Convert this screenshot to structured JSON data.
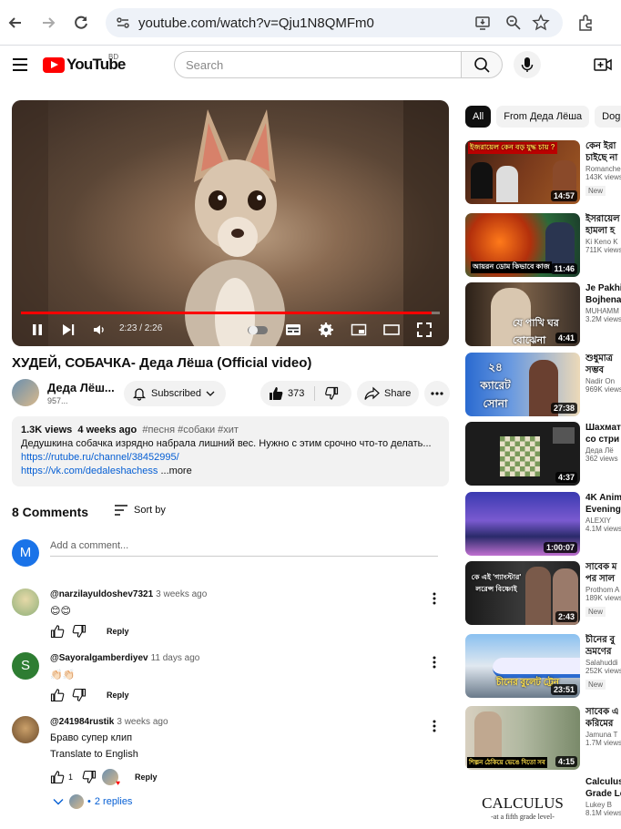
{
  "browser": {
    "url": "youtube.com/watch?v=Qju1N8QMFm0"
  },
  "header": {
    "logo_text": "YouTube",
    "country_code": "BD",
    "search_placeholder": "Search"
  },
  "player": {
    "time": "2:23 / 2:26",
    "progress_fraction": 0.98
  },
  "video": {
    "title": "ХУДЕЙ, СОБАЧКА- Деда Лёша (Official video)",
    "channel_name": "Деда Лёш...",
    "channel_subs": "957...",
    "subscribed_label": "Subscribed",
    "likes": "373",
    "share_label": "Share"
  },
  "description": {
    "views": "1.3K views",
    "age": "4 weeks ago",
    "tags": "#песня #собаки #хит",
    "text": "Дедушкина собачка изрядно набрала лишний вес. Нужно с этим срочно что-то делать...",
    "link1": "https://rutube.ru/channel/38452995/",
    "link2": "https://vk.com/dedaleshachess",
    "more": "...more"
  },
  "comments": {
    "count_label": "8 Comments",
    "sort_label": "Sort by",
    "my_avatar_letter": "M",
    "add_placeholder": "Add a comment...",
    "items": [
      {
        "author": "@narzilayuldoshev7321",
        "when": "3 weeks ago",
        "text": "😊😊",
        "reply": "Reply"
      },
      {
        "author": "@Sayoralgamberdiyev",
        "when": "11 days ago",
        "avatar_letter": "S",
        "text": "👏🏻👏🏻",
        "reply": "Reply"
      },
      {
        "author": "@241984rustik",
        "when": "3 weeks ago",
        "text": "Браво супер клип",
        "translate": "Translate to English",
        "likes": "1",
        "reply": "Reply",
        "replies": "2 replies"
      }
    ]
  },
  "sidebar": {
    "chips": [
      "All",
      "From Деда Лёша",
      "Dog"
    ],
    "recommendations": [
      {
        "title": "কেন ইরা",
        "title2": "চাইছে না",
        "channel": "Romanche",
        "views": "143K views",
        "badge": "New",
        "duration": "14:57",
        "thumb_text": "ইজরায়েল কেন বড় যুদ্ধ চায় ?"
      },
      {
        "title": "ইসরায়েল",
        "title2": "হামলা হ",
        "channel": "Ki Keno K",
        "views": "711K views",
        "badge": "",
        "duration": "11:46",
        "thumb_text": "আয়রন ডোম কিভাবে কাজ"
      },
      {
        "title": "Je Pakhi",
        "title2": "Bojhena",
        "channel": "MUHAMM",
        "views": "3.2M views",
        "badge": "",
        "duration": "4:41",
        "thumb_text": "যে পাখি ঘর বোঝেনা"
      },
      {
        "title": "শুধুমাত্র",
        "title2": "সম্ভব",
        "channel": "Nadir On",
        "views": "969K views",
        "badge": "",
        "duration": "27:38",
        "thumb_text": "২৪ ক্যারেট সোনা"
      },
      {
        "title": "Шахмат",
        "title2": "со стри",
        "channel": "Деда Лё",
        "views": "362 views",
        "badge": "",
        "duration": "4:37",
        "thumb_text": ""
      },
      {
        "title": "4K Anim",
        "title2": "Evening",
        "channel": "ALEXIY",
        "views": "4.1M views",
        "badge": "",
        "duration": "1:00:07",
        "thumb_text": ""
      },
      {
        "title": "সাবেক ম",
        "title2": "পর সাল",
        "channel": "Prothom A",
        "views": "189K views",
        "badge": "New",
        "duration": "2:43",
        "thumb_text": "কে এই 'গ্যাংস্টার' লরেন্স বিষ্ণোই"
      },
      {
        "title": "চীনের বু",
        "title2": "ভ্রমণের",
        "channel": "Salahuddi",
        "views": "252K views",
        "badge": "New",
        "duration": "23:51",
        "thumb_text": "চীনের বুলেট ট্রেন"
      },
      {
        "title": "সাবেক এ",
        "title2": "করিমের",
        "channel": "Jamuna T",
        "views": "1.7M views",
        "badge": "",
        "duration": "4:15",
        "thumb_text": "শিল্পন ঠেকিয়ে ভেঙে দিতো সব"
      },
      {
        "title": "Calculus",
        "title2": "Grade Le",
        "channel": "Lukey B",
        "views": "8.1M views",
        "badge": "",
        "duration": "",
        "thumb_text": "CALCULUS",
        "thumb_sub": "-at a fifth grade level-"
      }
    ]
  }
}
